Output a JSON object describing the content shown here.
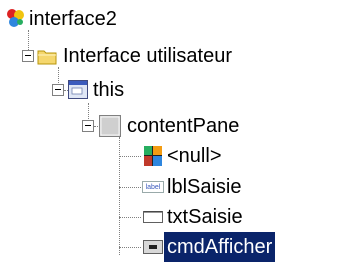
{
  "tree": {
    "root": {
      "label": "interface2",
      "icon": "project-icon"
    },
    "folder": {
      "label": "Interface utilisateur",
      "icon": "folder-icon"
    },
    "frame": {
      "label": "this",
      "icon": "window-icon"
    },
    "pane": {
      "label": "contentPane",
      "icon": "panel-icon"
    },
    "layout": {
      "label": "<null>",
      "icon": "layout-grid-icon"
    },
    "label_comp": {
      "label": "lblSaisie",
      "icon": "label-component-icon",
      "icon_text": "label"
    },
    "textfield": {
      "label": "txtSaisie",
      "icon": "textfield-icon"
    },
    "button": {
      "label": "cmdAfficher",
      "icon": "button-icon",
      "selected": true
    }
  },
  "colors": {
    "selection": "#0a246a",
    "folder": "#f5d76e"
  }
}
